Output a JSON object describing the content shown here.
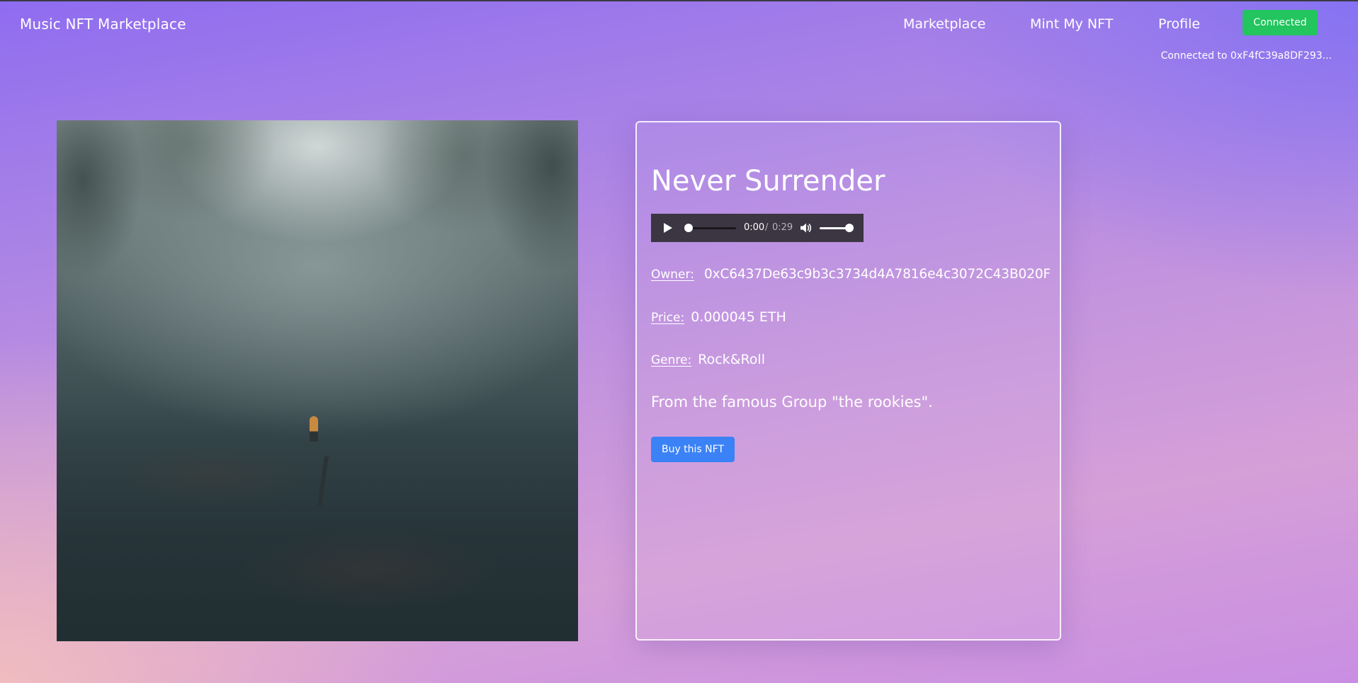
{
  "navbar": {
    "brand": "Music NFT Marketplace",
    "links": [
      {
        "label": "Marketplace"
      },
      {
        "label": "Mint My NFT"
      },
      {
        "label": "Profile"
      }
    ],
    "connect_button": "Connected",
    "connect_button_color": "#22c55e",
    "connected_to": "Connected to 0xF4fC39a8DF293..."
  },
  "artwork": {
    "alt": "Misty forest with a lone figure in an orange jacket"
  },
  "nft": {
    "title": "Never Surrender",
    "audio": {
      "current_time": "0:00",
      "separator": "/",
      "duration": "0:29",
      "progress": 0,
      "volume": 1,
      "play_icon": "play-icon",
      "volume_icon": "volume-icon"
    },
    "owner_label": "Owner:",
    "owner": "0xC6437De63c9b3c3734d4A7816e4c3072C43B020F",
    "price_label": "Price:",
    "price": "0.000045 ETH",
    "genre_label": "Genre:",
    "genre": "Rock&Roll",
    "description": "From the famous Group \"the rookies\".",
    "buy_button": "Buy this NFT",
    "buy_button_color": "#3b82f6"
  }
}
